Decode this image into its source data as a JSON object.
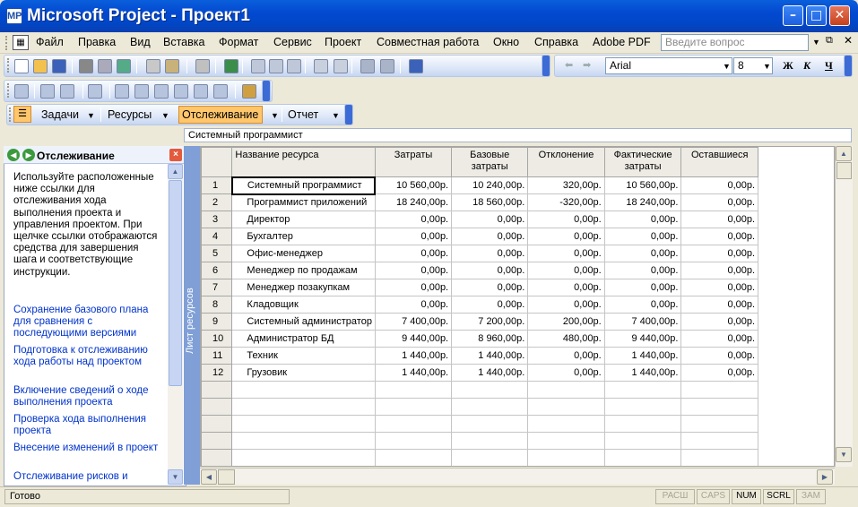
{
  "window": {
    "title": "Microsoft Project - Проект1",
    "app_icon_text": "MP"
  },
  "menu": {
    "items": [
      "Файл",
      "Правка",
      "Вид",
      "Вставка",
      "Формат",
      "Сервис",
      "Проект",
      "Совместная работа",
      "Окно",
      "Справка",
      "Adobe PDF"
    ],
    "help_placeholder": "Введите вопрос"
  },
  "formatting": {
    "font": "Arial",
    "size": "8",
    "bold": "Ж",
    "italic": "К",
    "underline": "Ч"
  },
  "viewbar": {
    "tasks": "Задачи",
    "resources": "Ресурсы",
    "tracking": "Отслеживание",
    "report": "Отчет"
  },
  "entry_bar": {
    "value": "Системный программист"
  },
  "task_pane": {
    "title": "Отслеживание",
    "description": "Используйте расположенные ниже ссылки для отслеживания хода выполнения проекта и управления проектом. При щелчке ссылки отображаются средства для завершения шага и соответствующие инструкции.",
    "links": [
      "Сохранение базового плана для сравнения с последующими версиями",
      "Подготовка к отслеживанию хода работы над проектом",
      "Включение сведений о ходе выполнения проекта",
      "Проверка хода выполнения проекта",
      "Внесение изменений в проект",
      "Отслеживание рисков и"
    ]
  },
  "sheet": {
    "side_label": "Лист ресурсов",
    "columns": [
      "Название ресурса",
      "Затраты",
      "Базовые затраты",
      "Отклонение",
      "Фактические затраты",
      "Оставшиеся"
    ],
    "rows": [
      {
        "id": "1",
        "name": "Системный программист",
        "cost": "10 560,00р.",
        "base": "10 240,00р.",
        "var": "320,00р.",
        "actual": "10 560,00р.",
        "rem": "0,00р."
      },
      {
        "id": "2",
        "name": "Программист приложений",
        "cost": "18 240,00р.",
        "base": "18 560,00р.",
        "var": "-320,00р.",
        "actual": "18 240,00р.",
        "rem": "0,00р."
      },
      {
        "id": "3",
        "name": "Директор",
        "cost": "0,00р.",
        "base": "0,00р.",
        "var": "0,00р.",
        "actual": "0,00р.",
        "rem": "0,00р."
      },
      {
        "id": "4",
        "name": "Бухгалтер",
        "cost": "0,00р.",
        "base": "0,00р.",
        "var": "0,00р.",
        "actual": "0,00р.",
        "rem": "0,00р."
      },
      {
        "id": "5",
        "name": "Офис-менеджер",
        "cost": "0,00р.",
        "base": "0,00р.",
        "var": "0,00р.",
        "actual": "0,00р.",
        "rem": "0,00р."
      },
      {
        "id": "6",
        "name": "Менеджер по продажам",
        "cost": "0,00р.",
        "base": "0,00р.",
        "var": "0,00р.",
        "actual": "0,00р.",
        "rem": "0,00р."
      },
      {
        "id": "7",
        "name": "Менеджер позакупкам",
        "cost": "0,00р.",
        "base": "0,00р.",
        "var": "0,00р.",
        "actual": "0,00р.",
        "rem": "0,00р."
      },
      {
        "id": "8",
        "name": "Кладовщик",
        "cost": "0,00р.",
        "base": "0,00р.",
        "var": "0,00р.",
        "actual": "0,00р.",
        "rem": "0,00р."
      },
      {
        "id": "9",
        "name": "Системный администратор",
        "cost": "7 400,00р.",
        "base": "7 200,00р.",
        "var": "200,00р.",
        "actual": "7 400,00р.",
        "rem": "0,00р."
      },
      {
        "id": "10",
        "name": "Администратор БД",
        "cost": "9 440,00р.",
        "base": "8 960,00р.",
        "var": "480,00р.",
        "actual": "9 440,00р.",
        "rem": "0,00р."
      },
      {
        "id": "11",
        "name": "Техник",
        "cost": "1 440,00р.",
        "base": "1 440,00р.",
        "var": "0,00р.",
        "actual": "1 440,00р.",
        "rem": "0,00р."
      },
      {
        "id": "12",
        "name": "Грузовик",
        "cost": "1 440,00р.",
        "base": "1 440,00р.",
        "var": "0,00р.",
        "actual": "1 440,00р.",
        "rem": "0,00р."
      }
    ]
  },
  "status": {
    "text": "Готово",
    "indicators": [
      {
        "label": "РАСШ",
        "on": false
      },
      {
        "label": "CAPS",
        "on": false
      },
      {
        "label": "NUM",
        "on": true
      },
      {
        "label": "SCRL",
        "on": true
      },
      {
        "label": "ЗАМ",
        "on": false
      }
    ]
  },
  "colors": {
    "titlebar": "#0349D0",
    "sideband": "#7F9FD6",
    "tracking_highlight": "#FFC66B",
    "link": "#0033CC"
  }
}
